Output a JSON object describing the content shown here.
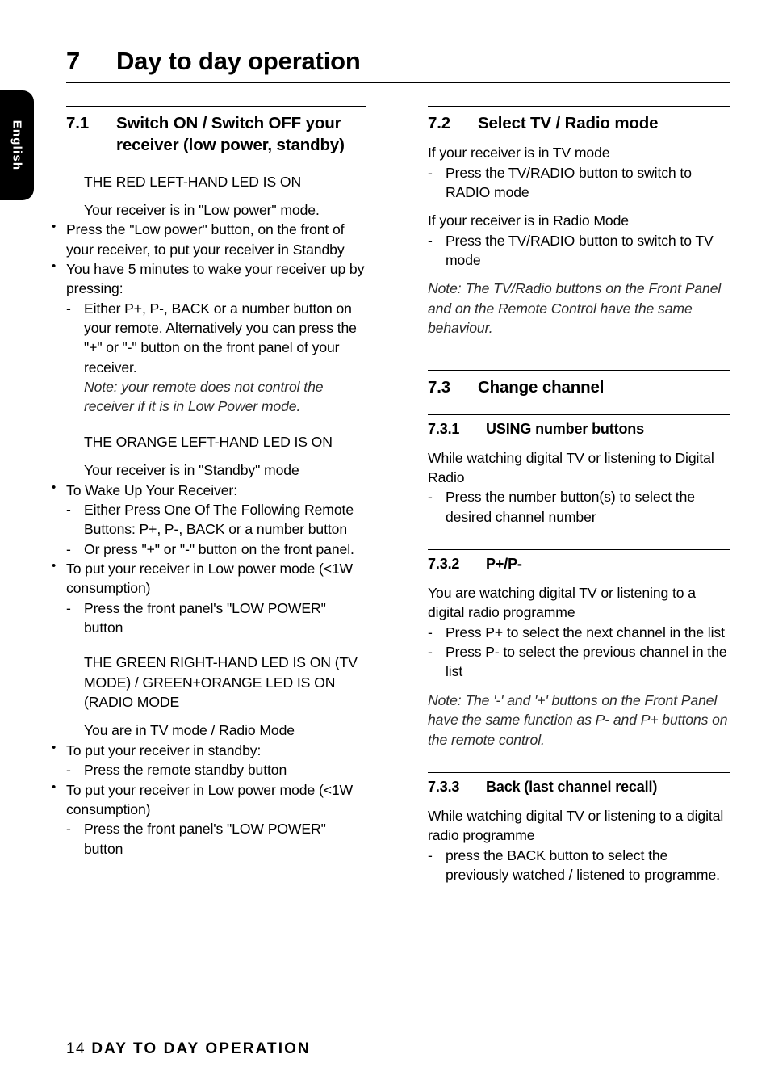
{
  "sidebar": {
    "language_tab": "English"
  },
  "chapter": {
    "number": "7",
    "title": "Day to day operation"
  },
  "footer": {
    "page_number": "14",
    "running_title": "DAY TO DAY OPERATION"
  },
  "left_column": {
    "section_7_1": {
      "number": "7.1",
      "title": "Switch ON / Switch OFF your receiver (low power, standby)",
      "state_red": "THE RED LEFT-HAND LED IS ON",
      "intro_red": "Your receiver is in \"Low power\" mode.",
      "bullets_red": [
        "Press the \"Low power\" button, on the front of your receiver,  to put your receiver in Standby",
        "You have 5 minutes to wake your receiver up by pressing:"
      ],
      "sub_red": [
        "Either P+, P-, BACK or a number button on your remote. Alternatively you can press the \"+\" or \"-\" button on the front panel of your receiver."
      ],
      "note_red": "Note: your remote does not control the receiver if it is in Low Power mode.",
      "state_orange": "THE ORANGE LEFT-HAND LED IS ON",
      "intro_orange": "Your receiver is in \"Standby\" mode",
      "orange_bullet_1": "To Wake Up Your Receiver:",
      "orange_sub_1": "Either Press One Of The Following Remote Buttons: P+, P-, BACK or a number button",
      "orange_sub_2": "Or press \"+\" or \"-\" button on the front panel.",
      "orange_bullet_2": "To put your receiver in Low power mode (<1W consumption)",
      "orange_sub_3": "Press the front panel's \"LOW POWER\" button",
      "state_green": "THE GREEN RIGHT-HAND LED IS ON (TV MODE) / GREEN+ORANGE LED IS ON (RADIO MODE",
      "intro_green": "You are in TV mode / Radio Mode",
      "green_bullet_1": "To put your receiver in standby:",
      "green_sub_1": "Press the remote standby button",
      "green_bullet_2": "To put your receiver in Low power mode (<1W consumption)",
      "green_sub_2": "Press the front panel's \"LOW POWER\" button"
    }
  },
  "right_column": {
    "section_7_2": {
      "number": "7.2",
      "title": "Select TV / Radio mode",
      "intro_tv": "If your receiver is in TV mode",
      "item_tv": "Press the TV/RADIO button to switch to RADIO mode",
      "intro_radio": "If your receiver is in Radio Mode",
      "item_radio": "Press the TV/RADIO button to switch to TV mode",
      "note": "Note: The TV/Radio buttons on the Front Panel and on the Remote Control have the same behaviour."
    },
    "section_7_3": {
      "number": "7.3",
      "title": "Change channel",
      "sub_7_3_1": {
        "number": "7.3.1",
        "title": "USING number buttons",
        "intro": "While watching digital TV or listening to Digital Radio",
        "item": "Press the number button(s) to select the desired channel number"
      },
      "sub_7_3_2": {
        "number": "7.3.2",
        "title": "P+/P-",
        "intro": "You are watching digital TV or listening to a digital radio programme",
        "item_1": "Press P+ to select the next channel in the list",
        "item_2": "Press P- to select the previous channel in the list",
        "note": "Note: The '-' and '+' buttons on the Front Panel have the same function as P- and P+ buttons on the remote control."
      },
      "sub_7_3_3": {
        "number": "7.3.3",
        "title": "Back (last channel recall)",
        "intro": "While watching digital TV or listening to a digital radio programme",
        "item": "press the BACK button to select the previously watched / listened to programme."
      }
    }
  },
  "symbols": {
    "bullet": "•",
    "dash": "-"
  }
}
